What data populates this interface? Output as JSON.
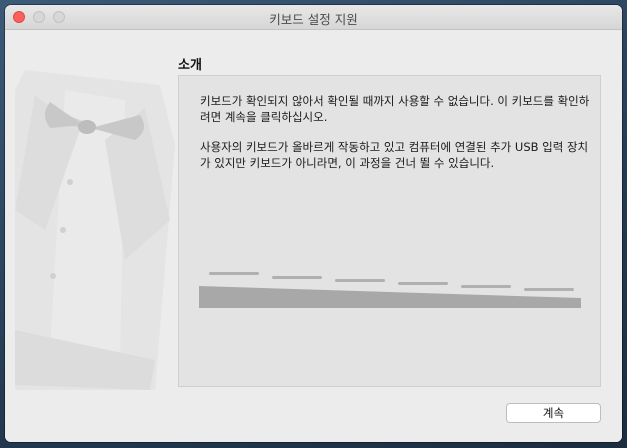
{
  "window": {
    "title": "키보드 설정 지원"
  },
  "intro": {
    "heading": "소개",
    "paragraph1_line1": "키보드가 확인되지 않아서 확인될 때까지 사용할 수 없습니다. 이 키보드를 확인하",
    "paragraph1_line2": "려면 계속을 클릭하십시오.",
    "paragraph2_line1": "사용자의 키보드가 올바르게 작동하고 있고 컴퓨터에 연결된 추가 USB 입력 장치",
    "paragraph2_line2": "가 있지만 키보드가 아니라면, 이 과정을 건너 뛸 수 있습니다."
  },
  "buttons": {
    "continue_label": "계속"
  },
  "colors": {
    "close": "#fc605b",
    "inactive_light": "#d7d7d7",
    "keyboard": "#a8a8a8"
  }
}
